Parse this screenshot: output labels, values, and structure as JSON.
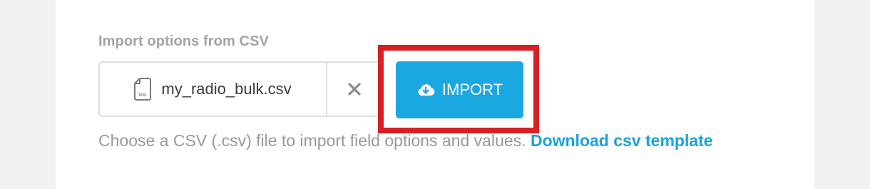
{
  "import_section": {
    "label": "Import options from CSV",
    "file_name": "my_radio_bulk.csv",
    "file_icon": "pdf-file-icon",
    "clear_icon": "close-icon",
    "import_label": "IMPORT",
    "import_icon": "cloud-download-icon",
    "help_text": "Choose a CSV (.csv) file to import field options and values. ",
    "help_link": "Download csv template"
  },
  "colors": {
    "accent": "#1ba7e0",
    "highlight": "#d71f24",
    "label": "#a3a3a3",
    "help_text": "#999999"
  }
}
